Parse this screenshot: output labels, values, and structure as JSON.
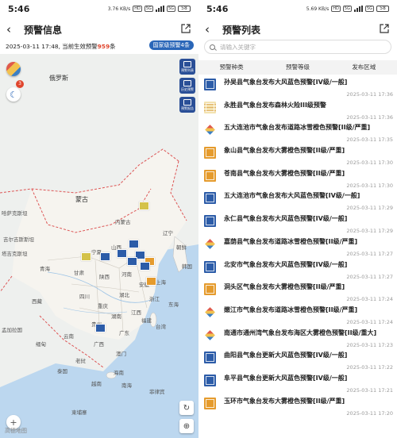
{
  "left": {
    "status": {
      "time": "5:46",
      "speed": "3.76 KB/s",
      "tags": [
        "HD",
        "5G",
        "5G"
      ],
      "battery": "58"
    },
    "header": {
      "title": "预警信息"
    },
    "summary": {
      "prefix": "2025-03-11 17:48, 当前生效预警",
      "count": "959",
      "suffix": "条",
      "badge": "国家级预警4条"
    },
    "map_badge": "3",
    "map_labels": [
      {
        "text": "俄罗斯",
        "big": true
      },
      {
        "text": "蒙古",
        "big": true
      },
      {
        "text": "哈萨克斯坦",
        "big": false
      },
      {
        "text": "吉尔吉斯斯坦",
        "big": false
      },
      {
        "text": "塔吉克斯坦",
        "big": false
      },
      {
        "text": "内蒙古",
        "big": false
      },
      {
        "text": "辽宁",
        "big": false
      },
      {
        "text": "朝鲜",
        "big": false
      },
      {
        "text": "韩国",
        "big": false
      },
      {
        "text": "宁夏",
        "big": false
      },
      {
        "text": "山西",
        "big": false
      },
      {
        "text": "甘肃",
        "big": false
      },
      {
        "text": "青海",
        "big": false
      },
      {
        "text": "陕西",
        "big": false
      },
      {
        "text": "河南",
        "big": false
      },
      {
        "text": "安徽",
        "big": false
      },
      {
        "text": "湖北",
        "big": false
      },
      {
        "text": "四川",
        "big": false
      },
      {
        "text": "重庆",
        "big": false
      },
      {
        "text": "湖南",
        "big": false
      },
      {
        "text": "江西",
        "big": false
      },
      {
        "text": "浙江",
        "big": false
      },
      {
        "text": "上海",
        "big": false
      },
      {
        "text": "西藏",
        "big": false
      },
      {
        "text": "贵州",
        "big": false
      },
      {
        "text": "云南",
        "big": false
      },
      {
        "text": "广西",
        "big": false
      },
      {
        "text": "广东",
        "big": false
      },
      {
        "text": "福建",
        "big": false
      },
      {
        "text": "台湾",
        "big": false
      },
      {
        "text": "东海",
        "big": false
      },
      {
        "text": "孟加拉国",
        "big": false
      },
      {
        "text": "缅甸",
        "big": false
      },
      {
        "text": "老挝",
        "big": false
      },
      {
        "text": "泰国",
        "big": false
      },
      {
        "text": "越南",
        "big": false
      },
      {
        "text": "海南",
        "big": false
      },
      {
        "text": "澳门",
        "big": false
      },
      {
        "text": "南海",
        "big": false
      },
      {
        "text": "柬埔寨",
        "big": false
      },
      {
        "text": "菲律宾",
        "big": false
      }
    ],
    "side_buttons": [
      {
        "label": "预警列表"
      },
      {
        "label": "历史预警"
      },
      {
        "label": "预警报告"
      }
    ],
    "watermark": "高德地图"
  },
  "right": {
    "status": {
      "time": "5:46",
      "speed": "5.69 KB/s",
      "tags": [
        "HD",
        "5G",
        "5G"
      ],
      "battery": "58"
    },
    "header": {
      "title": "预警列表"
    },
    "search": {
      "placeholder": "请输入关键字"
    },
    "filters": [
      "预警种类",
      "预警等级",
      "发布区域"
    ],
    "items": [
      {
        "title": "孙吴县气象台发布大风蓝色预警[IV级/一般]",
        "date": "2025-03-11 17:36",
        "icon": "blue"
      },
      {
        "title": "永胜县气象台发布森林火险III级预警",
        "date": "2025-03-11 17:36",
        "icon": "lines"
      },
      {
        "title": "五大连池市气象台发布道路冰雪橙色预警[II级/严重]",
        "date": "2025-03-11 17:35",
        "icon": "diamond"
      },
      {
        "title": "象山县气象台发布大雾橙色预警[II级/严重]",
        "date": "2025-03-11 17:30",
        "icon": "orange"
      },
      {
        "title": "苍南县气象台发布大雾橙色预警[II级/严重]",
        "date": "2025-03-11 17:30",
        "icon": "orange"
      },
      {
        "title": "五大连池市气象台发布大风蓝色预警[IV级/一般]",
        "date": "2025-03-11 17:29",
        "icon": "blue"
      },
      {
        "title": "永仁县气象台发布大风蓝色预警[IV级/一般]",
        "date": "2025-03-11 17:29",
        "icon": "blue"
      },
      {
        "title": "嘉荫县气象台发布道路冰雪橙色预警[II级/严重]",
        "date": "2025-03-11 17:27",
        "icon": "diamond"
      },
      {
        "title": "北安市气象台发布大风蓝色预警[IV级/一般]",
        "date": "2025-03-11 17:27",
        "icon": "blue"
      },
      {
        "title": "洞头区气象台发布大雾橙色预警[II级/严重]",
        "date": "2025-03-11 17:24",
        "icon": "orange"
      },
      {
        "title": "嫩江市气象台发布道路冰雪橙色预警[II级/严重]",
        "date": "2025-03-11 17:24",
        "icon": "diamond"
      },
      {
        "title": "南通市通州湾气象台发布海区大雾橙色预警[II级/重大]",
        "date": "2025-03-11 17:23",
        "icon": "diamond"
      },
      {
        "title": "曲阳县气象台更新大风蓝色预警[IV级/一般]",
        "date": "2025-03-11 17:22",
        "icon": "blue"
      },
      {
        "title": "阜平县气象台更新大风蓝色预警[IV级/一般]",
        "date": "2025-03-11 17:21",
        "icon": "blue"
      },
      {
        "title": "玉环市气象台发布大雾橙色预警[II级/严重]",
        "date": "2025-03-11 17:20",
        "icon": "orange"
      }
    ]
  },
  "colors": {
    "accent": "#2a66b8",
    "alert_count": "#e0452d",
    "warn_blue": "#2c5ca8",
    "warn_orange": "#e59b2d"
  }
}
